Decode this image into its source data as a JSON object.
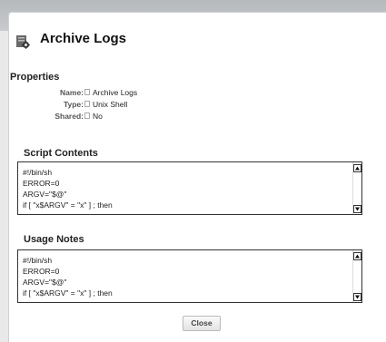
{
  "dialog": {
    "title": "Archive Logs",
    "title_icon": "gear-script-icon",
    "close_label": "Close"
  },
  "properties": {
    "heading": "Properties",
    "rows": [
      {
        "label": "Name:",
        "value": "Archive Logs"
      },
      {
        "label": "Type:",
        "value": "Unix Shell"
      },
      {
        "label": "Shared:",
        "value": "No"
      }
    ]
  },
  "script_contents": {
    "heading": "Script Contents",
    "lines": [
      "#!/bin/sh",
      "ERROR=0",
      "ARGV=\"$@\"",
      "if [ \"x$ARGV\" = \"x\" ] ; then"
    ]
  },
  "usage_notes": {
    "heading": "Usage Notes",
    "lines": [
      "#!/bin/sh",
      "ERROR=0",
      "ARGV=\"$@\"",
      "if [ \"x$ARGV\" = \"x\" ] ; then"
    ]
  },
  "colors": {
    "title_bar": "#b6b9bc",
    "dialog_bg": "#ffffff",
    "text": "#222222",
    "label": "#555555"
  }
}
